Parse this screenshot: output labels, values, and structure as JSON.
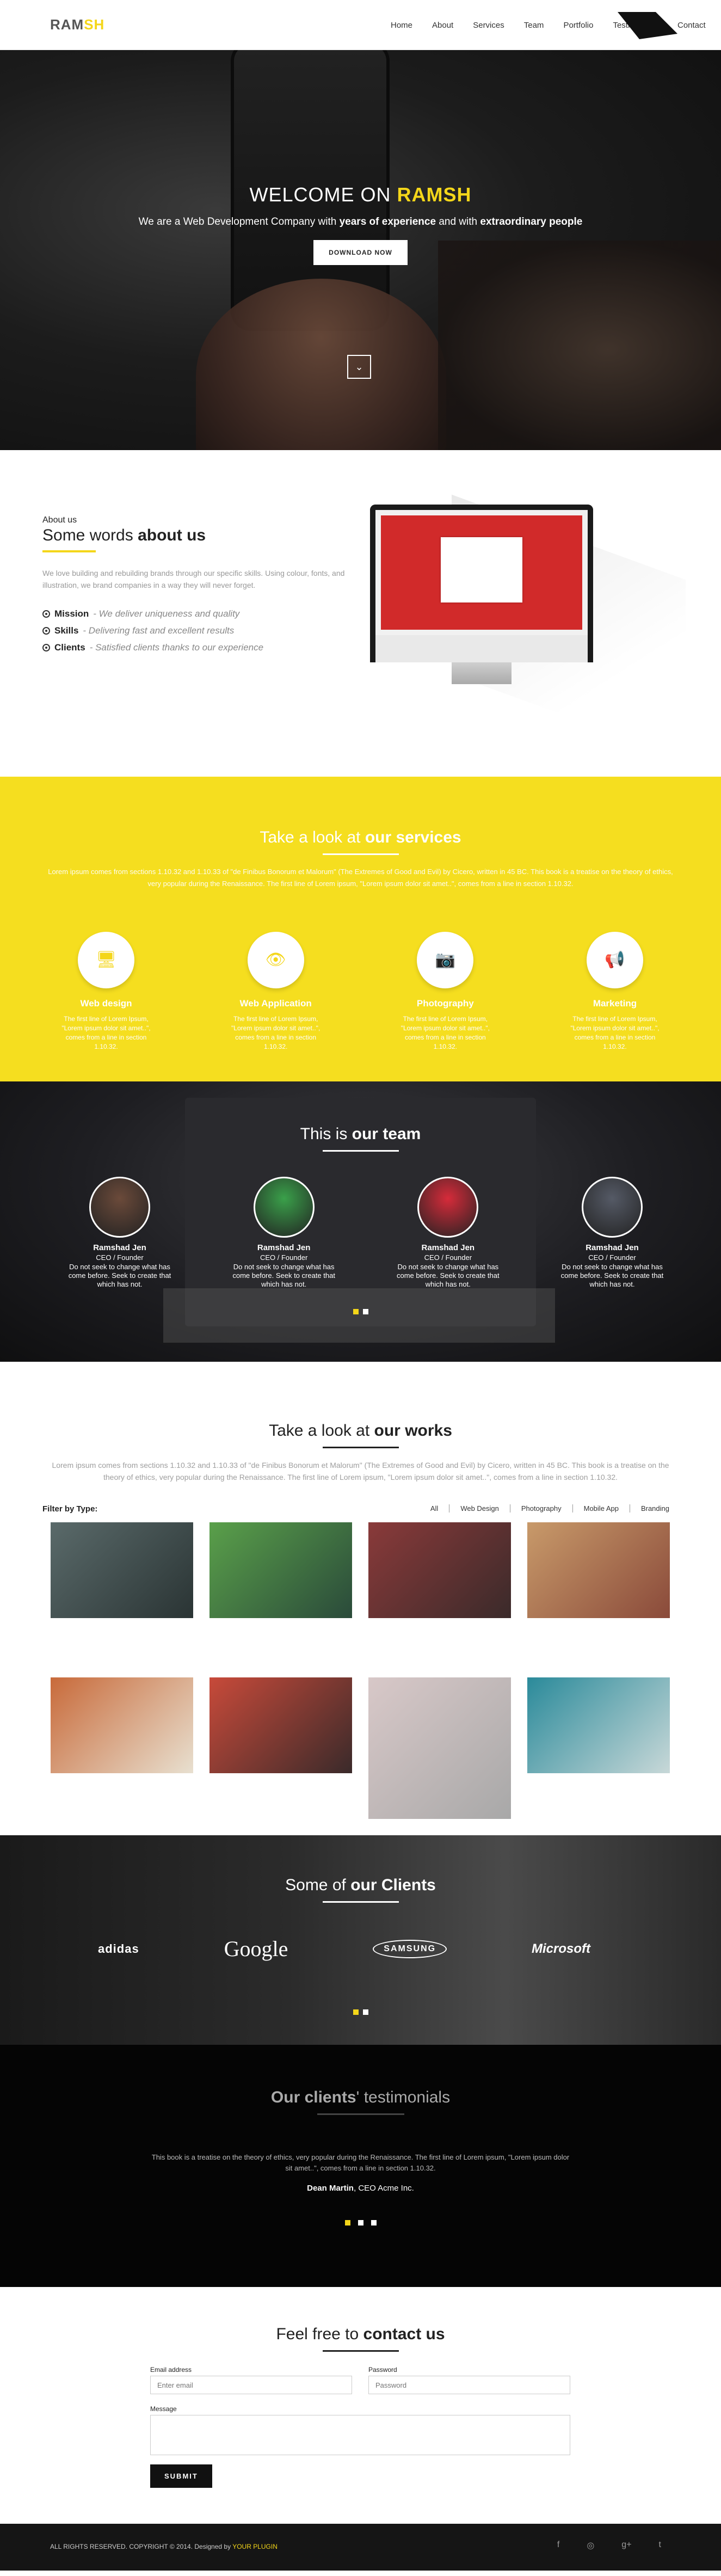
{
  "nav": {
    "logo_part1": "RAM",
    "logo_part2": "SH",
    "items": [
      "Home",
      "About",
      "Services",
      "Team",
      "Portfolio",
      "Testimonials",
      "Contact"
    ]
  },
  "hero": {
    "title_part1": "WELCOME ON ",
    "title_part2": "RAMSH",
    "subtitle_part1": "We are a Web Development Company with ",
    "subtitle_bold1": "years of experience",
    "subtitle_part2": " and with ",
    "subtitle_bold2": "extraordinary people",
    "button": "DOWNLOAD NOW",
    "arrow": "⌄"
  },
  "about": {
    "small": "About us",
    "big_part1": "Some words ",
    "big_part2": "about us",
    "desc": "We love building and rebuilding brands through our specific skills. Using colour, fonts, and illustration, we brand companies in a way they will never forget.",
    "items": [
      {
        "label": "Mission",
        "text": " - We deliver uniqueness and quality"
      },
      {
        "label": "Skills",
        "text": " - Delivering fast and excellent results"
      },
      {
        "label": "Clients",
        "text": " - Satisfied clients thanks to our experience"
      }
    ]
  },
  "services": {
    "title_part1": "Take a look at ",
    "title_part2": "our services",
    "desc": "Lorem ipsum comes from sections 1.10.32 and 1.10.33 of \"de Finibus Bonorum et Malorum\" (The Extremes of Good and Evil) by Cicero, written in 45 BC. This book is a treatise on the theory of ethics, very popular during the Renaissance. The first line of Lorem ipsum, \"Lorem ipsum dolor sit amet..\", comes from a line in section 1.10.32.",
    "items": [
      {
        "icon": "🖥",
        "name": "Web design",
        "text": "The first line of Lorem Ipsum, \"Lorem ipsum dolor sit amet..\", comes from a line in section 1.10.32."
      },
      {
        "icon": "👁",
        "name": "Web Application",
        "text": "The first line of Lorem Ipsum, \"Lorem ipsum dolor sit amet..\", comes from a line in section 1.10.32."
      },
      {
        "icon": "📷",
        "name": "Photography",
        "text": "The first line of Lorem Ipsum, \"Lorem ipsum dolor sit amet..\", comes from a line in section 1.10.32."
      },
      {
        "icon": "📢",
        "name": "Marketing",
        "text": "The first line of Lorem Ipsum, \"Lorem ipsum dolor sit amet..\", comes from a line in section 1.10.32."
      }
    ]
  },
  "team": {
    "title_part1": "This is ",
    "title_part2": "our team",
    "members": [
      {
        "name": "Ramshad Jen",
        "role": "CEO / Founder",
        "bio": "Do not seek to change what has come before. Seek to create that which has not.",
        "color": "#6b4a3a"
      },
      {
        "name": "Ramshad Jen",
        "role": "CEO / Founder",
        "bio": "Do not seek to change what has come before. Seek to create that which has not.",
        "color": "#3aa04a"
      },
      {
        "name": "Ramshad Jen",
        "role": "CEO / Founder",
        "bio": "Do not seek to change what has come before. Seek to create that which has not.",
        "color": "#d62b3a"
      },
      {
        "name": "Ramshad Jen",
        "role": "CEO / Founder",
        "bio": "Do not seek to change what has come before. Seek to create that which has not.",
        "color": "#555a66"
      }
    ]
  },
  "works": {
    "title_part1": "Take a look at ",
    "title_part2": "our works",
    "desc": "Lorem ipsum comes from sections 1.10.32 and 1.10.33 of \"de Finibus Bonorum et Malorum\" (The Extremes of Good and Evil) by Cicero, written in 45 BC. This book is a treatise on the theory of ethics, very popular during the Renaissance. The first line of Lorem ipsum, \"Lorem ipsum dolor sit amet..\", comes from a line in section 1.10.32.",
    "filter_label": "Filter by Type:",
    "filters": [
      "All",
      "Web Design",
      "Photography",
      "Mobile App",
      "Branding"
    ],
    "tiles": [
      {
        "c1": "#5a6a6a",
        "c2": "#2a3434"
      },
      {
        "c1": "#5aa04a",
        "c2": "#2a4a3a"
      },
      {
        "c1": "#8a3a3a",
        "c2": "#3a2a2a"
      },
      {
        "c1": "#c89a6a",
        "c2": "#8a4a3a"
      },
      {
        "c1": "#c86a3a",
        "c2": "#e8e0d0"
      },
      {
        "c1": "#c84a3a",
        "c2": "#3a2a2a"
      },
      {
        "c1": "#d8c8c8",
        "c2": "#a8a8a8"
      },
      {
        "c1": "#2a8a9a",
        "c2": "#c8d8d8"
      }
    ]
  },
  "clients": {
    "title_part1": "Some of ",
    "title_part2": "our Clients",
    "logos": [
      "adidas",
      "Google",
      "SAMSUNG",
      "Microsoft"
    ]
  },
  "testimonials": {
    "title_part1": "Our clients",
    "title_part2": "' testimonials",
    "quote": "This book is a treatise on the theory of ethics, very popular during the Renaissance. The first line of Lorem ipsum, \"Lorem ipsum dolor sit amet..\", comes from a line in section 1.10.32.",
    "author_name": "Dean Martin",
    "author_role": ", CEO Acme Inc."
  },
  "contact": {
    "title_part1": "Feel free to ",
    "title_part2": "contact us",
    "email_label": "Email address",
    "email_placeholder": "Enter email",
    "password_label": "Password",
    "password_placeholder": "Password",
    "message_label": "Message",
    "submit": "SUBMIT"
  },
  "footer": {
    "copy": "ALL RIGHTS RESERVED. COPYRIGHT © 2014. Designed by ",
    "brand": "YOUR PLUGIN",
    "social": [
      "f",
      "◎",
      "g+",
      "t"
    ]
  },
  "colors": {
    "accent": "#f4d61a",
    "dark": "#151515"
  }
}
